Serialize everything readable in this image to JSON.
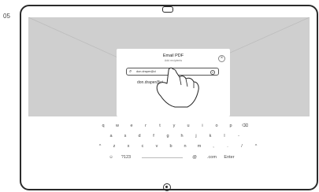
{
  "side_label": "05",
  "dialog": {
    "title": "Email PDF",
    "subtitle": "Add recipients",
    "search_value": "don.draper@ci",
    "result": "don.draper@ci",
    "close_glyph": "×",
    "clear_glyph": "×",
    "search_icon": "search-icon"
  },
  "keyboard": {
    "row1": [
      "q",
      "w",
      "e",
      "r",
      "t",
      "y",
      "u",
      "i",
      "o",
      "p",
      "⌫"
    ],
    "row2": [
      "a",
      "s",
      "d",
      "f",
      "g",
      "h",
      "j",
      "k",
      "l",
      "-"
    ],
    "row3": [
      "^",
      "z",
      "x",
      "c",
      "v",
      "b",
      "n",
      "m",
      ",",
      ".",
      "/",
      "^"
    ],
    "row4": {
      "emoji": "☺",
      "numbers": "?123",
      "at": "@",
      "dotcom": ".com",
      "enter": "Enter"
    }
  }
}
